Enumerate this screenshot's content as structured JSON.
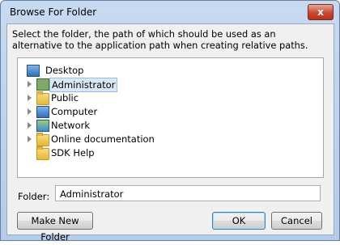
{
  "window": {
    "title": "Browse For Folder",
    "close_glyph": "x"
  },
  "description": "Select the folder, the path of which should be used as an alternative to the application path when creating relative paths.",
  "tree": {
    "root": {
      "label": "Desktop",
      "icon": "desktop-icon"
    },
    "items": [
      {
        "label": "Administrator",
        "icon": "user-folder-icon",
        "expandable": true,
        "selected": true
      },
      {
        "label": "Public",
        "icon": "folder-icon",
        "expandable": true,
        "selected": false
      },
      {
        "label": "Computer",
        "icon": "computer-icon",
        "expandable": true,
        "selected": false
      },
      {
        "label": "Network",
        "icon": "network-icon",
        "expandable": true,
        "selected": false
      },
      {
        "label": "Online documentation",
        "icon": "folder-icon",
        "expandable": true,
        "selected": false
      },
      {
        "label": "SDK Help",
        "icon": "folder-icon",
        "expandable": false,
        "selected": false
      }
    ]
  },
  "folder_field": {
    "label": "Folder:",
    "value": "Administrator"
  },
  "buttons": {
    "make_new_folder": "Make New Folder",
    "ok": "OK",
    "cancel": "Cancel"
  }
}
